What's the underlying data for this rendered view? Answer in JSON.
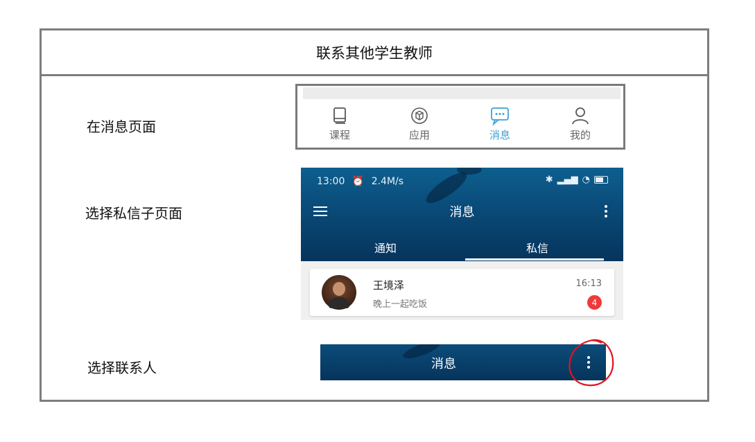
{
  "doc": {
    "title": "联系其他学生教师",
    "steps": [
      {
        "label": "在消息页面"
      },
      {
        "label": "选择私信子页面"
      },
      {
        "label": "选择联系人"
      }
    ]
  },
  "bottom_nav": {
    "items": [
      {
        "label": "课程",
        "icon": "book-icon"
      },
      {
        "label": "应用",
        "icon": "cube-icon"
      },
      {
        "label": "消息",
        "icon": "chat-icon",
        "active": true
      },
      {
        "label": "我的",
        "icon": "person-icon"
      }
    ],
    "active_color": "#3aa0d8",
    "inactive_color": "#666666"
  },
  "message_screen": {
    "status_time": "13:00",
    "status_speed": "2.4M/s",
    "title": "消息",
    "tabs": [
      "通知",
      "私信"
    ],
    "active_tab": "私信",
    "conversation": {
      "name": "王境泽",
      "preview": "晚上一起吃饭",
      "time": "16:13",
      "unread": "4"
    }
  },
  "header_bar": {
    "title": "消息"
  },
  "colors": {
    "frame_border": "#7d7d7d",
    "annotation_circle": "#e0141e",
    "header_blue": "#0a4a78",
    "badge_red": "#ee3a3a"
  }
}
